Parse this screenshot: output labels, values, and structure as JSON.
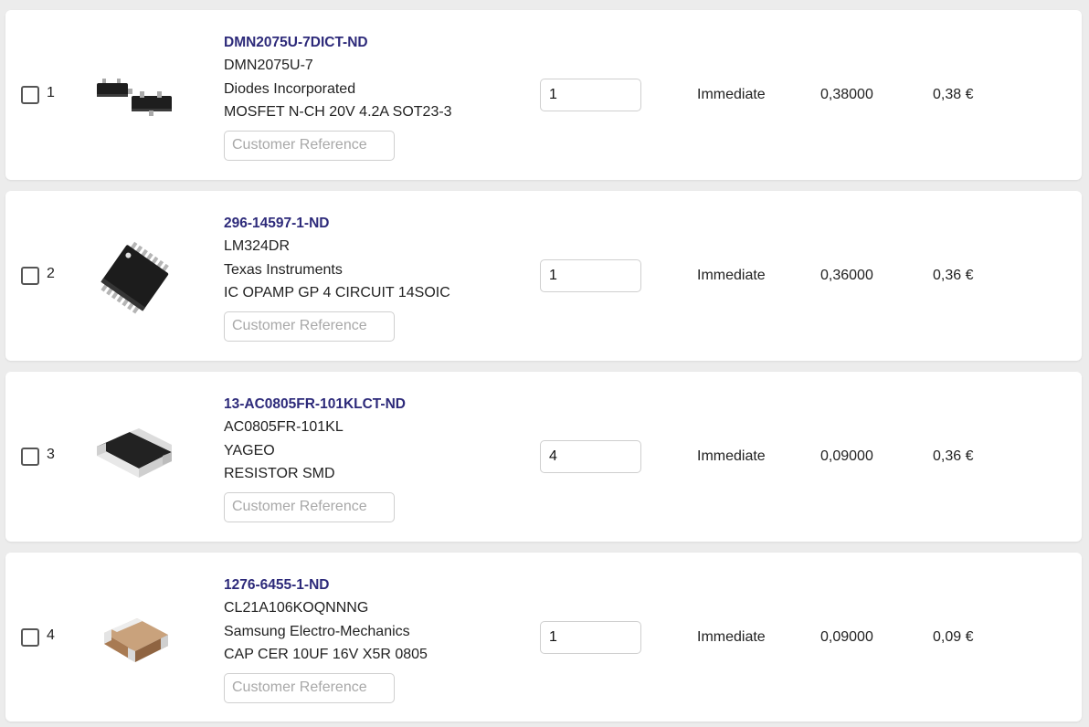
{
  "rows": [
    {
      "index": "1",
      "part_number": "DMN2075U-7DICT-ND",
      "mfr_part": "DMN2075U-7",
      "manufacturer": "Diodes Incorporated",
      "description": "MOSFET N-CH 20V 4.2A SOT23-3",
      "customer_ref_placeholder": "Customer Reference",
      "quantity": "1",
      "availability": "Immediate",
      "unit_price": "0,38000",
      "extended_price": "0,38 €",
      "image_icon": "sot23-package-icon"
    },
    {
      "index": "2",
      "part_number": "296-14597-1-ND",
      "mfr_part": "LM324DR",
      "manufacturer": "Texas Instruments",
      "description": "IC OPAMP GP 4 CIRCUIT 14SOIC",
      "customer_ref_placeholder": "Customer Reference",
      "quantity": "1",
      "availability": "Immediate",
      "unit_price": "0,36000",
      "extended_price": "0,36 €",
      "image_icon": "soic14-package-icon"
    },
    {
      "index": "3",
      "part_number": "13-AC0805FR-101KLCT-ND",
      "mfr_part": "AC0805FR-101KL",
      "manufacturer": "YAGEO",
      "description": "RESISTOR SMD",
      "customer_ref_placeholder": "Customer Reference",
      "quantity": "4",
      "availability": "Immediate",
      "unit_price": "0,09000",
      "extended_price": "0,36 €",
      "image_icon": "smd-resistor-icon"
    },
    {
      "index": "4",
      "part_number": "1276-6455-1-ND",
      "mfr_part": "CL21A106KOQNNNG",
      "manufacturer": "Samsung Electro-Mechanics",
      "description": "CAP CER 10UF 16V X5R 0805",
      "customer_ref_placeholder": "Customer Reference",
      "quantity": "1",
      "availability": "Immediate",
      "unit_price": "0,09000",
      "extended_price": "0,09 €",
      "image_icon": "smd-capacitor-icon"
    }
  ],
  "colors": {
    "part_link": "#2d2a7a",
    "page_background": "#ececec",
    "row_background": "#ffffff"
  }
}
